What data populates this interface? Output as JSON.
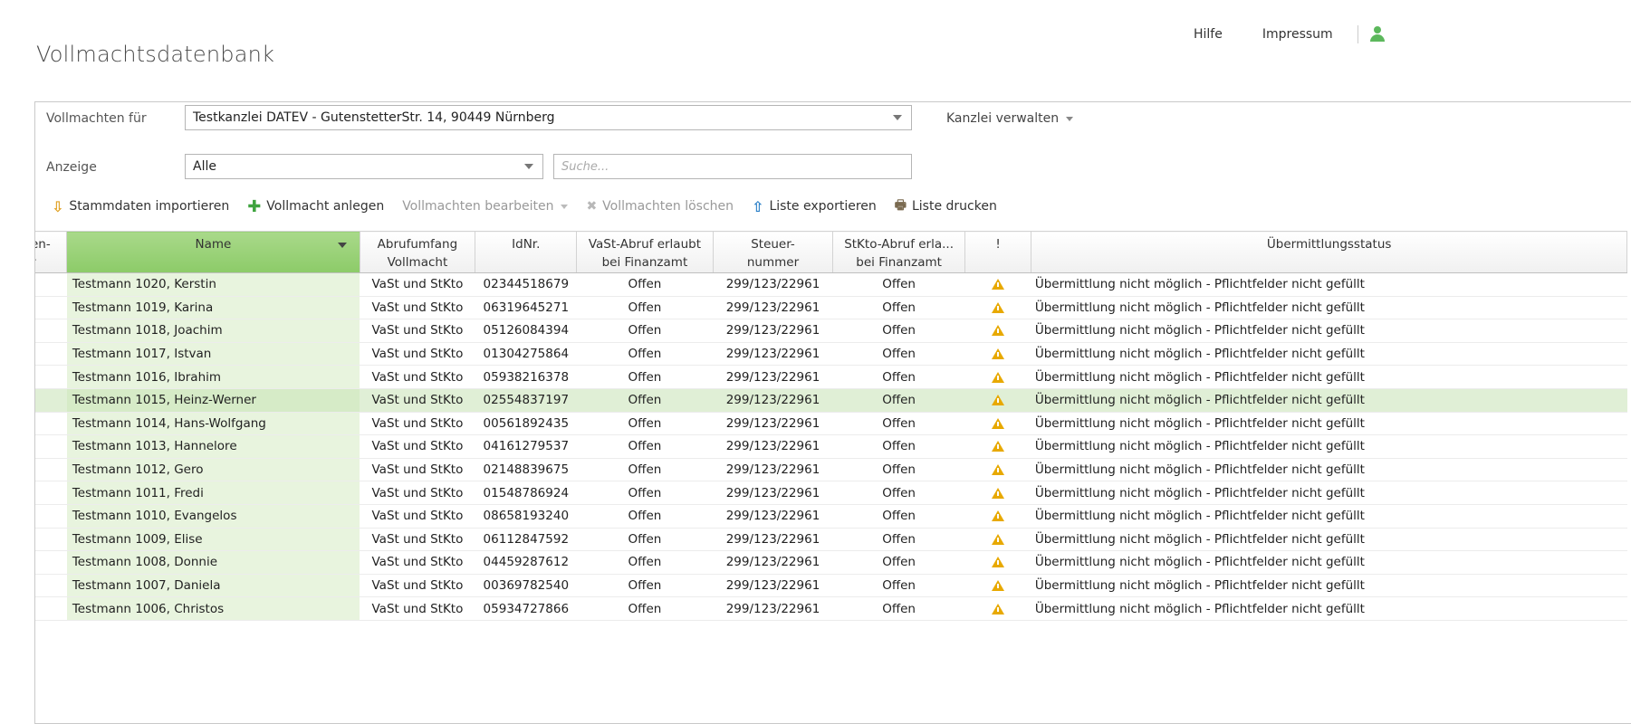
{
  "app": {
    "title": "Vollmachtsdatenbank"
  },
  "top_links": {
    "help": "Hilfe",
    "impressum": "Impressum"
  },
  "filters": {
    "vollmachten_label": "Vollmachten für",
    "kanzlei_value": "Testkanzlei DATEV - GutenstetterStr. 14, 90449 Nürnberg",
    "kanzlei_verwalten": "Kanzlei verwalten",
    "anzeige_label": "Anzeige",
    "anzeige_value": "Alle",
    "search_placeholder": "Suche..."
  },
  "toolbar": {
    "import": "Stammdaten importieren",
    "add": "Vollmacht anlegen",
    "edit": "Vollmachten bearbeiten",
    "delete": "Vollmachten löschen",
    "export": "Liste exportieren",
    "print": "Liste drucken"
  },
  "colors": {
    "accent_green": "#8ccb68",
    "warning": "#e8a900"
  },
  "table": {
    "columns": [
      {
        "key": "first",
        "label": "en-\nr"
      },
      {
        "key": "name",
        "label": "Name"
      },
      {
        "key": "abrufumfang",
        "label": "Abrufumfang\nVollmacht"
      },
      {
        "key": "idnr",
        "label": "IdNr."
      },
      {
        "key": "vast",
        "label": "VaSt-Abruf erlaubt\nbei Finanzamt"
      },
      {
        "key": "steuernr",
        "label": "Steuer-\nnummer"
      },
      {
        "key": "stkto",
        "label": "StKto-Abruf erla...\nbei Finanzamt"
      },
      {
        "key": "warn",
        "label": "!"
      },
      {
        "key": "status",
        "label": "Übermittlungsstatus"
      }
    ],
    "rows": [
      {
        "name": "Testmann 1020, Kerstin",
        "abrufumfang": "VaSt und StKto",
        "idnr": "02344518679",
        "vast": "Offen",
        "steuernr": "299/123/22961",
        "stkto": "Offen",
        "status": "Übermittlung nicht möglich - Pflichtfelder nicht gefüllt"
      },
      {
        "name": "Testmann 1019, Karina",
        "abrufumfang": "VaSt und StKto",
        "idnr": "06319645271",
        "vast": "Offen",
        "steuernr": "299/123/22961",
        "stkto": "Offen",
        "status": "Übermittlung nicht möglich - Pflichtfelder nicht gefüllt"
      },
      {
        "name": "Testmann 1018, Joachim",
        "abrufumfang": "VaSt und StKto",
        "idnr": "05126084394",
        "vast": "Offen",
        "steuernr": "299/123/22961",
        "stkto": "Offen",
        "status": "Übermittlung nicht möglich - Pflichtfelder nicht gefüllt"
      },
      {
        "name": "Testmann 1017, Istvan",
        "abrufumfang": "VaSt und StKto",
        "idnr": "01304275864",
        "vast": "Offen",
        "steuernr": "299/123/22961",
        "stkto": "Offen",
        "status": "Übermittlung nicht möglich - Pflichtfelder nicht gefüllt"
      },
      {
        "name": "Testmann 1016, Ibrahim",
        "abrufumfang": "VaSt und StKto",
        "idnr": "05938216378",
        "vast": "Offen",
        "steuernr": "299/123/22961",
        "stkto": "Offen",
        "status": "Übermittlung nicht möglich - Pflichtfelder nicht gefüllt"
      },
      {
        "name": "Testmann 1015, Heinz-Werner",
        "abrufumfang": "VaSt und StKto",
        "idnr": "02554837197",
        "vast": "Offen",
        "steuernr": "299/123/22961",
        "stkto": "Offen",
        "status": "Übermittlung nicht möglich - Pflichtfelder nicht gefüllt",
        "selected": true
      },
      {
        "name": "Testmann 1014, Hans-Wolfgang",
        "abrufumfang": "VaSt und StKto",
        "idnr": "00561892435",
        "vast": "Offen",
        "steuernr": "299/123/22961",
        "stkto": "Offen",
        "status": "Übermittlung nicht möglich - Pflichtfelder nicht gefüllt"
      },
      {
        "name": "Testmann 1013, Hannelore",
        "abrufumfang": "VaSt und StKto",
        "idnr": "04161279537",
        "vast": "Offen",
        "steuernr": "299/123/22961",
        "stkto": "Offen",
        "status": "Übermittlung nicht möglich - Pflichtfelder nicht gefüllt"
      },
      {
        "name": "Testmann 1012, Gero",
        "abrufumfang": "VaSt und StKto",
        "idnr": "02148839675",
        "vast": "Offen",
        "steuernr": "299/123/22961",
        "stkto": "Offen",
        "status": "Übermittlung nicht möglich - Pflichtfelder nicht gefüllt"
      },
      {
        "name": "Testmann 1011, Fredi",
        "abrufumfang": "VaSt und StKto",
        "idnr": "01548786924",
        "vast": "Offen",
        "steuernr": "299/123/22961",
        "stkto": "Offen",
        "status": "Übermittlung nicht möglich - Pflichtfelder nicht gefüllt"
      },
      {
        "name": "Testmann 1010, Evangelos",
        "abrufumfang": "VaSt und StKto",
        "idnr": "08658193240",
        "vast": "Offen",
        "steuernr": "299/123/22961",
        "stkto": "Offen",
        "status": "Übermittlung nicht möglich - Pflichtfelder nicht gefüllt"
      },
      {
        "name": "Testmann 1009, Elise",
        "abrufumfang": "VaSt und StKto",
        "idnr": "06112847592",
        "vast": "Offen",
        "steuernr": "299/123/22961",
        "stkto": "Offen",
        "status": "Übermittlung nicht möglich - Pflichtfelder nicht gefüllt"
      },
      {
        "name": "Testmann 1008, Donnie",
        "abrufumfang": "VaSt und StKto",
        "idnr": "04459287612",
        "vast": "Offen",
        "steuernr": "299/123/22961",
        "stkto": "Offen",
        "status": "Übermittlung nicht möglich - Pflichtfelder nicht gefüllt"
      },
      {
        "name": "Testmann 1007, Daniela",
        "abrufumfang": "VaSt und StKto",
        "idnr": "00369782540",
        "vast": "Offen",
        "steuernr": "299/123/22961",
        "stkto": "Offen",
        "status": "Übermittlung nicht möglich - Pflichtfelder nicht gefüllt"
      },
      {
        "name": "Testmann 1006, Christos",
        "abrufumfang": "VaSt und StKto",
        "idnr": "05934727866",
        "vast": "Offen",
        "steuernr": "299/123/22961",
        "stkto": "Offen",
        "status": "Übermittlung nicht möglich - Pflichtfelder nicht gefüllt"
      }
    ]
  }
}
